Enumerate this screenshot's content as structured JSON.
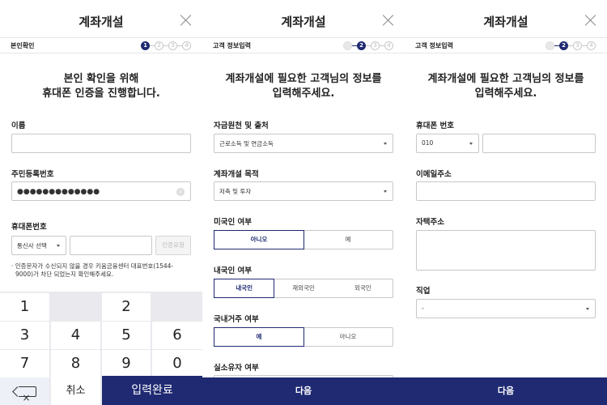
{
  "screens": [
    {
      "title": "계좌개설",
      "step_label": "본인확인",
      "steps": [
        "1",
        "2",
        "3",
        "4"
      ],
      "heading_line1": "본인 확인을 위해",
      "heading_line2": "휴대폰 인증을 진행합니다.",
      "name_label": "이름",
      "name_value": "",
      "rrn_label": "주민등록번호",
      "rrn_value": "●●●●●●●●●●●●●",
      "phone_label": "휴대폰번호",
      "carrier_select": "통신사 선택",
      "phone_value": "",
      "send_button": "인증요청",
      "note_line1": "· 인증문자가 수신되지 않을 경우 키움금융센터 대표번호(1544-",
      "note_line2": "9000)가 차단 되었는지 확인해주세요.",
      "keypad": {
        "k1": "1",
        "k2": "2",
        "k3": "3",
        "k4": "4",
        "k5": "5",
        "k6": "6",
        "k7": "7",
        "k8": "8",
        "k9": "9",
        "k0": "0",
        "cancel": "취소",
        "done": "입력완료"
      }
    },
    {
      "title": "계좌개설",
      "step_label": "고객 정보입력",
      "steps": [
        "1",
        "2",
        "3",
        "4"
      ],
      "heading_line1": "계좌개설에 필요한 고객님의 정보를",
      "heading_line2": "입력해주세요.",
      "fund_label": "자금원천 및 출처",
      "fund_value": "근로소득 및 연금소득",
      "purpose_label": "계좌개설 목적",
      "purpose_value": "저축 및 투자",
      "us_label": "미국인 여부",
      "us_options": [
        "아니오",
        "예"
      ],
      "nationality_label": "내국인 여부",
      "nationality_options": [
        "내국인",
        "재외국민",
        "외국인"
      ],
      "residence_label": "국내거주 여부",
      "residence_options": [
        "예",
        "아니오"
      ],
      "owner_label": "실소유자 여부",
      "next_button": "다음"
    },
    {
      "title": "계좌개설",
      "step_label": "고객 정보입력",
      "steps": [
        "1",
        "2",
        "3",
        "4"
      ],
      "heading_line1": "계좌개설에 필요한 고객님의 정보를",
      "heading_line2": "입력해주세요.",
      "phone_label": "휴대폰 번호",
      "phone_prefix": "010",
      "email_label": "이메일주소",
      "address_label": "자택주소",
      "job_label": "직업",
      "job_value": "-",
      "next_button": "다음"
    }
  ],
  "colors": {
    "primary": "#1f2a72",
    "keypad_bg": "#e9e9ee",
    "border": "#c8c8c8"
  }
}
